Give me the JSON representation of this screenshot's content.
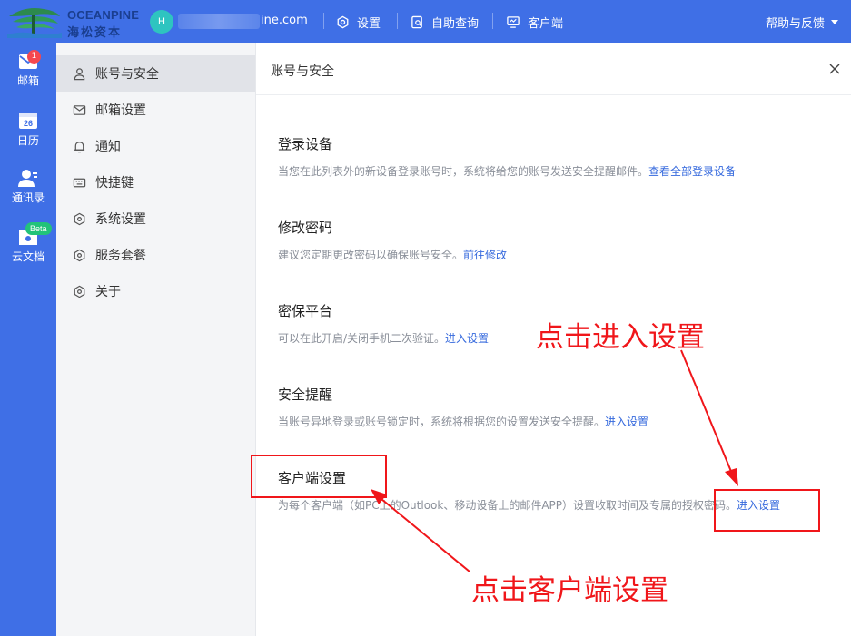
{
  "brand": {
    "name_en": "OCEANPINE",
    "name_cn": "海松资本",
    "colors": {
      "primary": "#3f6fe6",
      "accent": "#2ec4c0",
      "link": "#3569dd",
      "annotation": "#f0161a"
    }
  },
  "header": {
    "avatar_letter": "H",
    "account_suffix": "ine.com",
    "nav": [
      {
        "label": "设置",
        "icon": "settings-gear-icon"
      },
      {
        "label": "自助查询",
        "icon": "self-query-icon"
      },
      {
        "label": "客户端",
        "icon": "desktop-client-icon"
      }
    ],
    "help_label": "帮助与反馈"
  },
  "rail": {
    "items": [
      {
        "label": "邮箱",
        "icon": "mail-icon",
        "badge": "1"
      },
      {
        "label": "日历",
        "icon": "calendar-icon",
        "day": "26"
      },
      {
        "label": "通讯录",
        "icon": "contacts-icon"
      },
      {
        "label": "云文档",
        "icon": "cloud-doc-icon",
        "tag": "Beta"
      }
    ]
  },
  "menu": {
    "items": [
      {
        "label": "账号与安全",
        "icon": "user-icon",
        "active": true
      },
      {
        "label": "邮箱设置",
        "icon": "mail-outline-icon"
      },
      {
        "label": "通知",
        "icon": "bell-icon"
      },
      {
        "label": "快捷键",
        "icon": "keyboard-icon"
      },
      {
        "label": "系统设置",
        "icon": "hexagon-gear-icon"
      },
      {
        "label": "服务套餐",
        "icon": "hexagon-gear-icon"
      },
      {
        "label": "关于",
        "icon": "hexagon-gear-icon"
      }
    ]
  },
  "panel": {
    "title": "账号与安全",
    "sections": [
      {
        "title": "登录设备",
        "desc": "当您在此列表外的新设备登录账号时，系统将给您的账号发送安全提醒邮件。",
        "link": "查看全部登录设备"
      },
      {
        "title": "修改密码",
        "desc": "建议您定期更改密码以确保账号安全。",
        "link": "前往修改"
      },
      {
        "title": "密保平台",
        "desc": "可以在此开启/关闭手机二次验证。",
        "link": "进入设置"
      },
      {
        "title": "安全提醒",
        "desc": "当账号异地登录或账号锁定时，系统将根据您的设置发送安全提醒。",
        "link": "进入设置"
      },
      {
        "title": "客户端设置",
        "desc": "为每个客户端（如PC上的Outlook、移动设备上的邮件APP）设置收取时间及专属的授权密码。",
        "link": "进入设置"
      }
    ]
  },
  "annotations": {
    "enter_settings": "点击进入设置",
    "client_settings": "点击客户端设置"
  }
}
